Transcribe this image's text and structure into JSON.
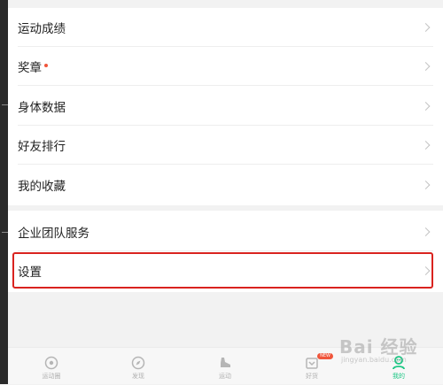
{
  "menu": {
    "group1": [
      {
        "label": "运动成绩",
        "dot": false
      },
      {
        "label": "奖章",
        "dot": true
      },
      {
        "label": "身体数据",
        "dot": false
      },
      {
        "label": "好友排行",
        "dot": false
      },
      {
        "label": "我的收藏",
        "dot": false
      }
    ],
    "group2": [
      {
        "label": "企业团队服务"
      },
      {
        "label": "设置",
        "highlighted": true
      }
    ]
  },
  "tabbar": {
    "tabs": [
      {
        "label": "运动圈",
        "icon": "compass-icon",
        "active": false
      },
      {
        "label": "发现",
        "icon": "discover-icon",
        "active": false
      },
      {
        "label": "运动",
        "icon": "shoe-icon",
        "active": false
      },
      {
        "label": "好货",
        "icon": "shop-icon",
        "active": false,
        "badge": "NEW"
      },
      {
        "label": "我的",
        "icon": "profile-icon",
        "active": true
      }
    ]
  },
  "watermark": {
    "logo": "Bai 经验",
    "url": "jingyan.baidu.com"
  },
  "colors": {
    "accent": "#1ec785",
    "highlight_border": "#d9231f",
    "dot": "#f0553b"
  }
}
